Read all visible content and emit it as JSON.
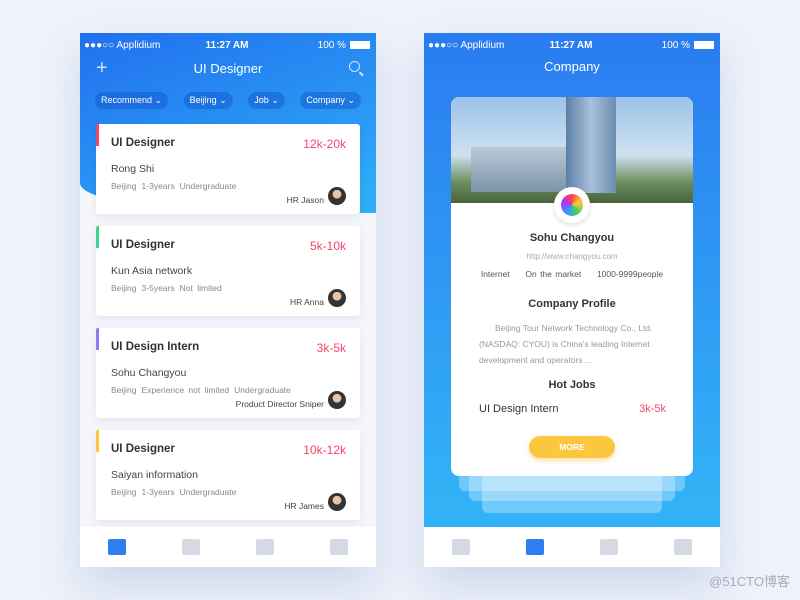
{
  "status": {
    "carrier": "Applidium",
    "time": "11:27 AM",
    "battery": "100 %"
  },
  "list_screen": {
    "title": "UI Designer",
    "filters": [
      "Recommend",
      "Beijing",
      "Job",
      "Company"
    ],
    "jobs": [
      {
        "title": "UI  Designer",
        "salary": "12k-20k",
        "company": "Rong Shi",
        "tags": [
          "Beijing",
          "1-3years",
          "Undergraduate"
        ],
        "hr": "HR  Jason",
        "accent": "#f5456a"
      },
      {
        "title": "UI  Designer",
        "salary": "5k-10k",
        "company": "Kun Asia network",
        "tags": [
          "Beijing",
          "3-5years",
          "Not limited"
        ],
        "hr": "HR  Anna",
        "accent": "#3ed68c"
      },
      {
        "title": "UI Design Intern",
        "salary": "3k-5k",
        "company": "Sohu Changyou",
        "tags": [
          "Beijing",
          "Experience not limited",
          "Undergraduate"
        ],
        "hr": "Product Director  Sniper",
        "accent": "#8e7bf5"
      },
      {
        "title": "UI  Designer",
        "salary": "10k-12k",
        "company": "Saiyan information",
        "tags": [
          "Beijing",
          "1-3years",
          "Undergraduate"
        ],
        "hr": "HR  James",
        "accent": "#fcc63e"
      }
    ]
  },
  "company_screen": {
    "title": "Company",
    "name": "Sohu Changyou",
    "url": "http://www.changyou.com",
    "facts": [
      "Internet",
      "On the market",
      "1000-9999people"
    ],
    "profile_heading": "Company Profile",
    "profile_text": "Beijing Tour Network Technology Co., Ltd. (NASDAQ: CYOU) is China's leading Internet development and operators ...",
    "hot_jobs_heading": "Hot Jobs",
    "hot_job": {
      "title": "UI Design Intern",
      "salary": "3k-5k"
    },
    "more_label": "MORE"
  },
  "tabbar": [
    "home-icon",
    "building-icon",
    "message-icon",
    "profile-icon"
  ],
  "watermark": "@51CTO博客"
}
